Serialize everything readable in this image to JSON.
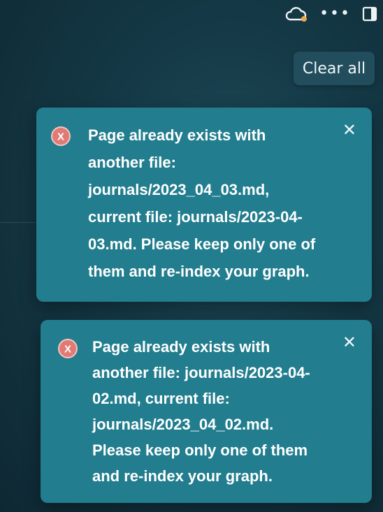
{
  "topbar": {
    "icons": [
      "cloud-sync-icon",
      "more-icon",
      "sidebar-toggle-icon"
    ],
    "more_label": "•••"
  },
  "clear_all": {
    "label": "Clear all"
  },
  "notifications": [
    {
      "icon": "error-x-icon",
      "message": "Page already exists with another file: journals/2023_04_03.md, current file: journals/2023-04-03.md. Please keep only one of them and re-index your graph.",
      "close_label": "✕"
    },
    {
      "icon": "error-x-icon",
      "message": "Page already exists with another file: journals/2023-04-02.md, current file: journals/2023_04_02.md. Please keep only one of them and re-index your graph.",
      "close_label": "✕"
    }
  ],
  "colors": {
    "background": "#143845",
    "toast": "#227d8e",
    "button": "#214d5d",
    "error_icon": "#e07a74",
    "sync_dot": "#f0a94a"
  }
}
